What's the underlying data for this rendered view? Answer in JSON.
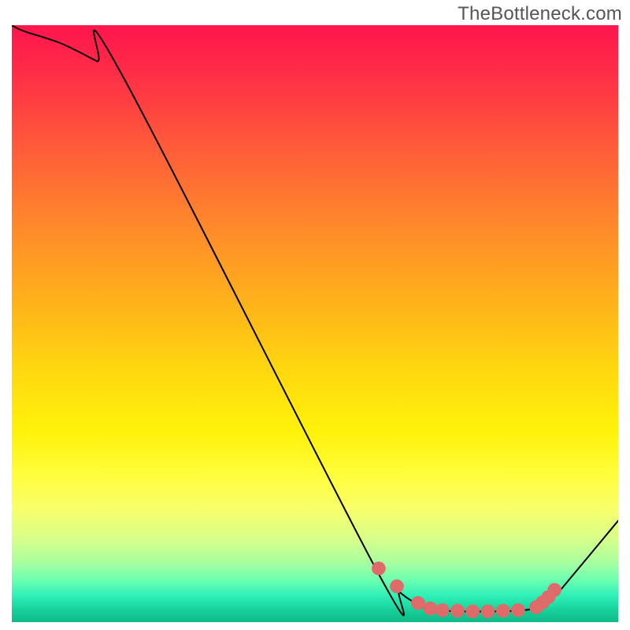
{
  "watermark": "TheBottleneck.com",
  "chart_data": {
    "type": "line",
    "title": "",
    "xlabel": "",
    "ylabel": "",
    "xlim": [
      0,
      100
    ],
    "ylim": [
      0,
      100
    ],
    "series": [
      {
        "name": "curve",
        "x": [
          0,
          2,
          8,
          14,
          18,
          60,
          64,
          67,
          70,
          80,
          86,
          88,
          90,
          91,
          100
        ],
        "y": [
          100,
          99,
          97,
          94,
          92,
          9,
          5,
          3,
          2,
          1.8,
          2.2,
          3,
          5,
          6,
          17
        ]
      }
    ],
    "markers": {
      "name": "dots",
      "color_hex": "#de6a6a",
      "x": [
        60.5,
        63.5,
        67,
        69,
        71,
        73.5,
        76,
        78.5,
        81,
        83.5,
        86.5,
        87.5,
        88.5,
        89.5
      ],
      "y": [
        9.0,
        6.0,
        3.2,
        2.3,
        2.0,
        1.9,
        1.8,
        1.8,
        1.9,
        2.0,
        2.5,
        3.3,
        4.2,
        5.4
      ]
    },
    "gradient_stops": [
      {
        "pos": 0.0,
        "color": "#ff154d"
      },
      {
        "pos": 0.5,
        "color": "#ffd80f"
      },
      {
        "pos": 0.76,
        "color": "#fffd40"
      },
      {
        "pos": 0.9,
        "color": "#a8ffa0"
      },
      {
        "pos": 1.0,
        "color": "#0fba88"
      }
    ]
  }
}
